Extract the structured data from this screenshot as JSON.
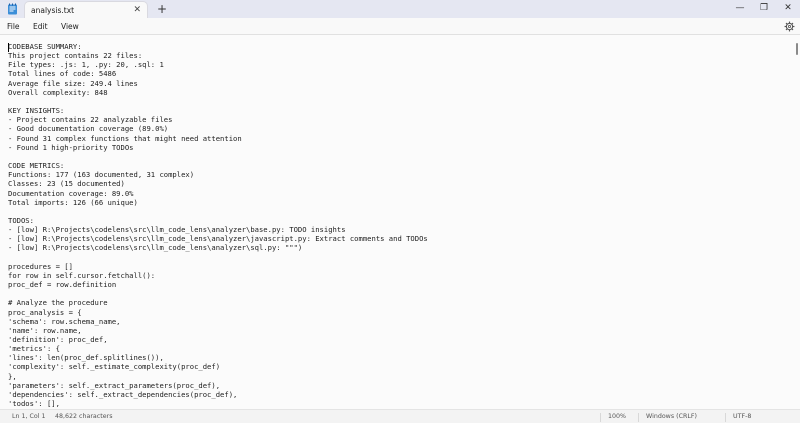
{
  "tab": {
    "title": "analysis.txt",
    "close_glyph": "✕",
    "new_tab_glyph": "+"
  },
  "window": {
    "minimize_glyph": "—",
    "maximize_glyph": "❐",
    "close_glyph": "✕"
  },
  "menu": {
    "file": "File",
    "edit": "Edit",
    "view": "View"
  },
  "editor": {
    "lines": [
      "CODEBASE SUMMARY:",
      "This project contains 22 files:",
      "File types: .js: 1, .py: 20, .sql: 1",
      "Total lines of code: 5486",
      "Average file size: 249.4 lines",
      "Overall complexity: 848",
      "",
      "KEY INSIGHTS:",
      "- Project contains 22 analyzable files",
      "- Good documentation coverage (89.0%)",
      "- Found 31 complex functions that might need attention",
      "- Found 1 high-priority TODOs",
      "",
      "CODE METRICS:",
      "Functions: 177 (163 documented, 31 complex)",
      "Classes: 23 (15 documented)",
      "Documentation coverage: 89.0%",
      "Total imports: 126 (66 unique)",
      "",
      "TODOS:",
      "- [low] R:\\Projects\\codelens\\src\\llm_code_lens\\analyzer\\base.py: TODO insights",
      "- [low] R:\\Projects\\codelens\\src\\llm_code_lens\\analyzer\\javascript.py: Extract comments and TODOs",
      "- [low] R:\\Projects\\codelens\\src\\llm_code_lens\\analyzer\\sql.py: \"\"\")",
      "",
      "procedures = []",
      "for row in self.cursor.fetchall():",
      "proc_def = row.definition",
      "",
      "# Analyze the procedure",
      "proc_analysis = {",
      "'schema': row.schema_name,",
      "'name': row.name,",
      "'definition': proc_def,",
      "'metrics': {",
      "'lines': len(proc_def.splitlines()),",
      "'complexity': self._estimate_complexity(proc_def)",
      "},",
      "'parameters': self._extract_parameters(proc_def),",
      "'dependencies': self._extract_dependencies(proc_def),",
      "'todos': [],"
    ]
  },
  "status": {
    "position": "Ln 1, Col 1",
    "characters": "48,622 characters",
    "zoom": "100%",
    "line_ending": "Windows (CRLF)",
    "encoding": "UTF-8"
  },
  "icons": {
    "app": "notepad-icon",
    "settings": "gear-icon"
  }
}
